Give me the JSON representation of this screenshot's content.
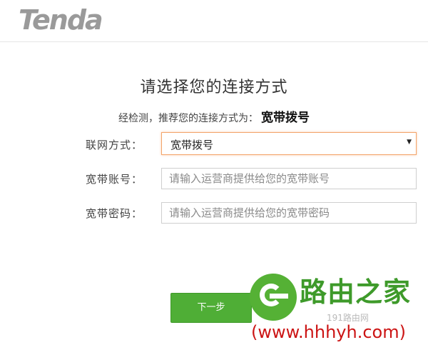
{
  "brand": {
    "logo": "Tenda"
  },
  "page": {
    "title": "请选择您的连接方式",
    "detect_prefix": "经检测，推荐您的连接方式为：",
    "detect_value": "宽带拨号"
  },
  "form": {
    "connection_label": "联网方式：",
    "connection_value": "宽带拨号",
    "account_label": "宽带账号：",
    "account_placeholder": "请输入运营商提供给您的宽带账号",
    "password_label": "宽带密码：",
    "password_placeholder": "请输入运营商提供给您的宽带密码"
  },
  "actions": {
    "next_label": "下一步"
  },
  "watermark": {
    "title": "路由之家",
    "sub": "191路由网",
    "url": "(www.hhhyh.com)"
  },
  "colors": {
    "accent_green": "#4fae36",
    "select_border": "#f3a56a",
    "logo_gray": "#9a9a9a",
    "watermark_red": "#cc1414"
  },
  "icons": {
    "select_arrow": "triangle-down-icon",
    "watermark_logo": "e-logo-icon"
  }
}
